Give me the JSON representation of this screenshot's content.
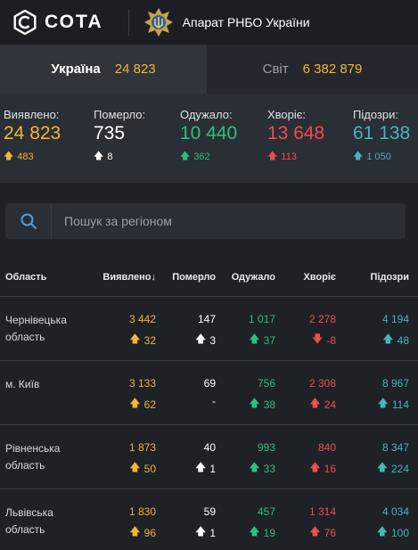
{
  "header": {
    "logo_text": "СОТА",
    "agency": "Апарат РНБО України",
    "logo_icon": "sota-logo-icon",
    "emblem_icon": "rnbo-emblem-icon"
  },
  "tabs": [
    {
      "label": "Україна",
      "value": "24 823",
      "active": true
    },
    {
      "label": "Світ",
      "value": "6 382 879",
      "active": false
    }
  ],
  "stats": [
    {
      "label": "Виявлено:",
      "value": "24 823",
      "delta": "483",
      "color": "#f4b532"
    },
    {
      "label": "Померло:",
      "value": "735",
      "delta": "8",
      "color": "#ffffff"
    },
    {
      "label": "Одужало:",
      "value": "10 440",
      "delta": "362",
      "color": "#2bc17b"
    },
    {
      "label": "Хворіє:",
      "value": "13 648",
      "delta": "113",
      "color": "#ef4d4d"
    },
    {
      "label": "Підозри:",
      "value": "61 138",
      "delta": "1 050",
      "color": "#45b5b9"
    }
  ],
  "search": {
    "placeholder": "Пошук за регіоном",
    "icon": "search-icon"
  },
  "table": {
    "headers": [
      "Область",
      "Виявлено",
      "Померло",
      "Одужало",
      "Хворіє",
      "Підозри"
    ],
    "sort_indicator": "↓",
    "rows": [
      {
        "region_line1": "Чернівецька",
        "region_line2": "область",
        "detected": "3 442",
        "detected_d": "32",
        "died": "147",
        "died_d": "3",
        "recovered": "1 017",
        "recovered_d": "37",
        "sick": "2 278",
        "sick_d": "-8",
        "suspected": "4 194",
        "suspected_d": "48"
      },
      {
        "region_line1": "м. Київ",
        "region_line2": "",
        "detected": "3 133",
        "detected_d": "62",
        "died": "69",
        "died_d": "-",
        "recovered": "756",
        "recovered_d": "38",
        "sick": "2 308",
        "sick_d": "24",
        "suspected": "8 967",
        "suspected_d": "114"
      },
      {
        "region_line1": "Рівненська",
        "region_line2": "область",
        "detected": "1 873",
        "detected_d": "50",
        "died": "40",
        "died_d": "1",
        "recovered": "993",
        "recovered_d": "33",
        "sick": "840",
        "sick_d": "16",
        "suspected": "8 347",
        "suspected_d": "224"
      },
      {
        "region_line1": "Львівська",
        "region_line2": "область",
        "detected": "1 830",
        "detected_d": "96",
        "died": "59",
        "died_d": "1",
        "recovered": "457",
        "recovered_d": "19",
        "sick": "1 314",
        "sick_d": "76",
        "suspected": "4 034",
        "suspected_d": "100"
      }
    ]
  }
}
